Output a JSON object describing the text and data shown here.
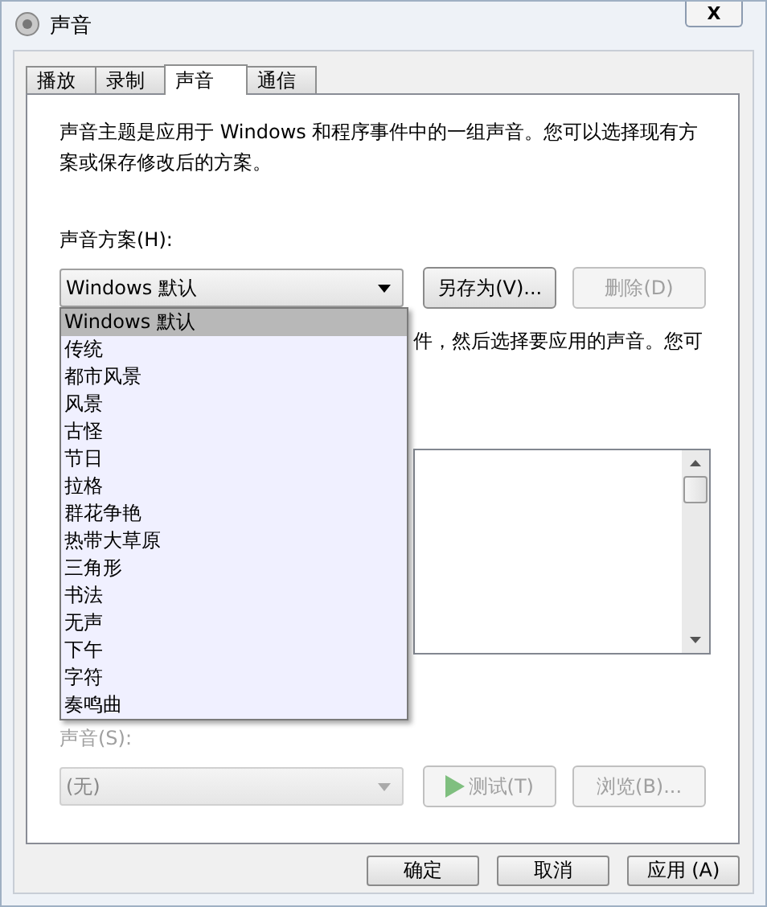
{
  "window": {
    "title": "声音",
    "close": "X"
  },
  "tabs": [
    {
      "label": "播放",
      "selected": false
    },
    {
      "label": "录制",
      "selected": false
    },
    {
      "label": "声音",
      "selected": true
    },
    {
      "label": "通信",
      "selected": false
    }
  ],
  "description": "声音主题是应用于 Windows 和程序事件中的一组声音。您可以选择现有方案或保存修改后的方案。",
  "scheme": {
    "label": "声音方案(H):",
    "value": "Windows 默认",
    "save_as": {
      "label": "另存为(V)...",
      "disabled": false
    },
    "delete": {
      "label": "删除(D)",
      "disabled": true
    },
    "options": [
      {
        "label": "Windows 默认",
        "selected": true
      },
      {
        "label": "传统",
        "selected": false
      },
      {
        "label": "都市风景",
        "selected": false
      },
      {
        "label": "风景",
        "selected": false
      },
      {
        "label": "古怪",
        "selected": false
      },
      {
        "label": "节日",
        "selected": false
      },
      {
        "label": "拉格",
        "selected": false
      },
      {
        "label": "群花争艳",
        "selected": false
      },
      {
        "label": "热带大草原",
        "selected": false
      },
      {
        "label": "三角形",
        "selected": false
      },
      {
        "label": "书法",
        "selected": false
      },
      {
        "label": "无声",
        "selected": false
      },
      {
        "label": "下午",
        "selected": false
      },
      {
        "label": "字符",
        "selected": false
      },
      {
        "label": "奏鸣曲",
        "selected": false
      }
    ]
  },
  "partial_text": "件，然后选择要应用的声音。您可",
  "sound": {
    "label": "声音(S):",
    "value": "(无)",
    "disabled": true,
    "test": {
      "label": "测试(T)",
      "disabled": true
    },
    "browse": {
      "label": "浏览(B)...",
      "disabled": true
    }
  },
  "buttons": [
    "确定",
    "取消",
    "应用 (A)"
  ]
}
